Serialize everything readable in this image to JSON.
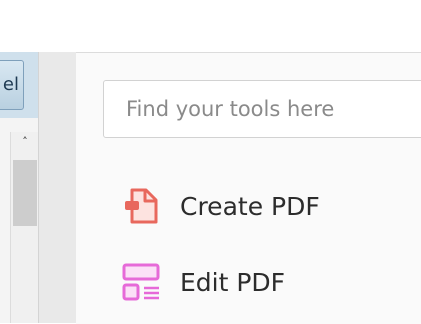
{
  "left_pane": {
    "button_partial_label": "el"
  },
  "scrollbar": {
    "up_arrow_glyph": "˄"
  },
  "tools_panel": {
    "search": {
      "placeholder": "Find your tools here",
      "value": ""
    },
    "tools": [
      {
        "label": "Create PDF",
        "icon": "create-pdf-icon",
        "color": "#e8685d"
      },
      {
        "label": "Edit PDF",
        "icon": "edit-pdf-icon",
        "color": "#e66ad8"
      }
    ]
  }
}
